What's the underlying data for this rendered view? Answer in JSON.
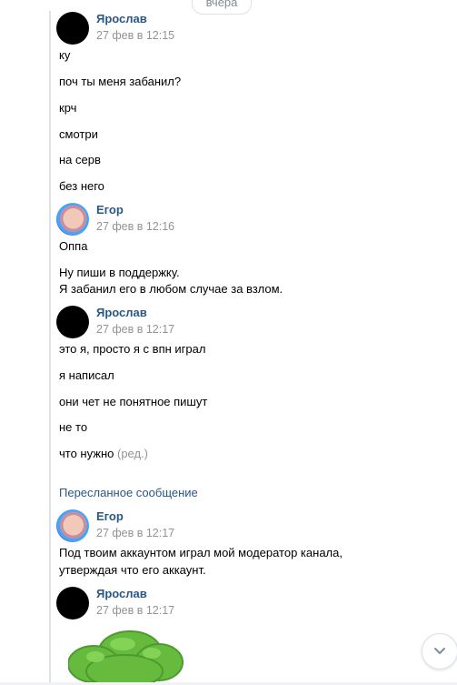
{
  "date_separator": "вчера",
  "messages": [
    {
      "author": "Ярослав",
      "time": "27 фев в 12:15",
      "lines": [
        "ку",
        "поч ты меня забанил?",
        "крч",
        "смотри",
        "на серв",
        "без него"
      ]
    },
    {
      "author": "Егор",
      "time": "27 фев в 12:16",
      "lines": [
        "Оппа",
        "Ну пиши в поддержку.",
        "Я забанил его в любом случае за взлом."
      ]
    },
    {
      "author": "Ярослав",
      "time": "27 фев в 12:17",
      "lines": [
        "это я, просто я с впн играл",
        "я написал",
        "они чет не понятное пишут",
        "не то",
        "что нужно"
      ],
      "edited_label": "(ред.)"
    }
  ],
  "forwarded": {
    "label": "Пересланное сообщение",
    "author": "Егор",
    "time": "27 фев в 12:17",
    "lines": [
      "Под твоим аккаунтом играл мой модератор канала,",
      "утверждая что его аккаунт."
    ]
  },
  "last_message": {
    "author": "Ярослав",
    "time": "27 фев в 12:17",
    "sticker": "green-bush-sticker"
  },
  "scroll_button_icon": "chevron-down-icon"
}
